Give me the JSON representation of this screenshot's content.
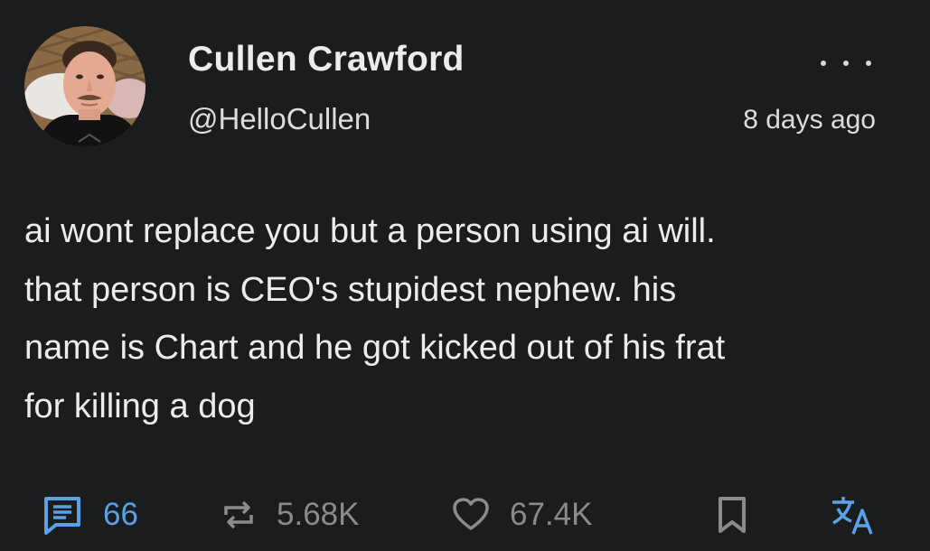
{
  "post": {
    "author": {
      "display_name": "Cullen Crawford",
      "handle": "@HelloCullen"
    },
    "timestamp": "8 days ago",
    "text_lines": [
      "ai wont replace you but a person using ai will.",
      "that person is CEO's stupidest nephew. his",
      "name is Chart and he got kicked out of his frat",
      "for killing a dog"
    ],
    "actions": {
      "comments": {
        "icon": "comment-icon",
        "count": "66"
      },
      "reposts": {
        "icon": "repost-icon",
        "count": "5.68K"
      },
      "likes": {
        "icon": "heart-icon",
        "count": "67.4K"
      },
      "bookmark": {
        "icon": "bookmark-icon"
      },
      "translate": {
        "icon": "translate-icon"
      }
    }
  },
  "colors": {
    "background": "#1b1c1e",
    "accent": "#5aa1e6",
    "muted": "#8a8b8d",
    "text": "#ececec"
  }
}
